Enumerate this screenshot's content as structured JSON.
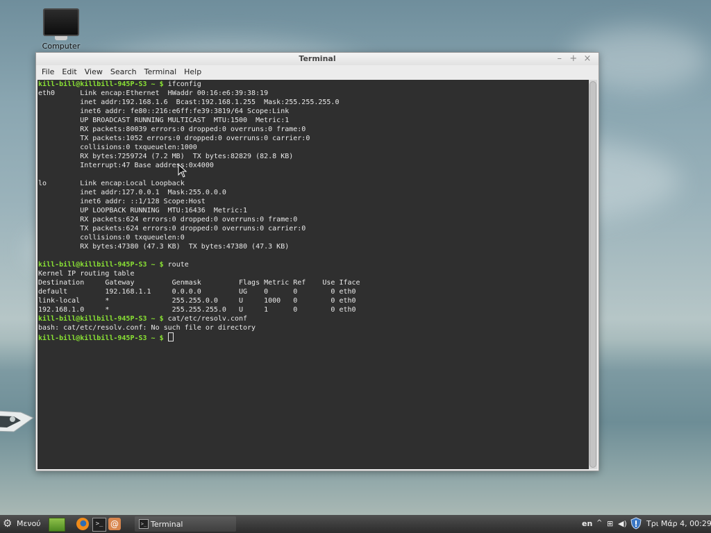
{
  "desktop": {
    "icon_label": "Computer"
  },
  "window": {
    "title": "Terminal",
    "controls": {
      "minimize": "–",
      "maximize": "+",
      "close": "×"
    },
    "menu": [
      "File",
      "Edit",
      "View",
      "Search",
      "Terminal",
      "Help"
    ]
  },
  "terminal": {
    "prompt": "kill-bill@killbill-945P-S3 ~ $",
    "commands": [
      "ifconfig",
      "route",
      "cat/etc/resolv.conf"
    ],
    "ifconfig_output": [
      "eth0      Link encap:Ethernet  HWaddr 00:16:e6:39:38:19",
      "          inet addr:192.168.1.6  Bcast:192.168.1.255  Mask:255.255.255.0",
      "          inet6 addr: fe80::216:e6ff:fe39:3819/64 Scope:Link",
      "          UP BROADCAST RUNNING MULTICAST  MTU:1500  Metric:1",
      "          RX packets:80039 errors:0 dropped:0 overruns:0 frame:0",
      "          TX packets:1052 errors:0 dropped:0 overruns:0 carrier:0",
      "          collisions:0 txqueuelen:1000",
      "          RX bytes:7259724 (7.2 MB)  TX bytes:82829 (82.8 KB)",
      "          Interrupt:47 Base address:0x4000",
      "",
      "lo        Link encap:Local Loopback",
      "          inet addr:127.0.0.1  Mask:255.0.0.0",
      "          inet6 addr: ::1/128 Scope:Host",
      "          UP LOOPBACK RUNNING  MTU:16436  Metric:1",
      "          RX packets:624 errors:0 dropped:0 overruns:0 frame:0",
      "          TX packets:624 errors:0 dropped:0 overruns:0 carrier:0",
      "          collisions:0 txqueuelen:0",
      "          RX bytes:47380 (47.3 KB)  TX bytes:47380 (47.3 KB)",
      ""
    ],
    "route_output": [
      "Kernel IP routing table",
      "Destination     Gateway         Genmask         Flags Metric Ref    Use Iface",
      "default         192.168.1.1     0.0.0.0         UG    0      0        0 eth0",
      "link-local      *               255.255.0.0     U     1000   0        0 eth0",
      "192.168.1.0     *               255.255.255.0   U     1      0        0 eth0"
    ],
    "error_output": "bash: cat/etc/resolv.conf: No such file or directory"
  },
  "taskbar": {
    "menu_label": "Μενού",
    "task_label": "Terminal",
    "terminal_launcher_glyph": ">_",
    "terminal_task_glyph": ">_",
    "mail_launcher_glyph": "@",
    "tray_language": "en",
    "tray_arrow": "^",
    "tray_network_glyph": "⊞",
    "tray_volume_glyph": "◀)",
    "clock": "Τρι Μάρ  4, 00:29"
  },
  "colors": {
    "prompt": "#8ae234",
    "terminal_bg": "#2f2f2f",
    "terminal_fg": "#e9e9e9"
  }
}
